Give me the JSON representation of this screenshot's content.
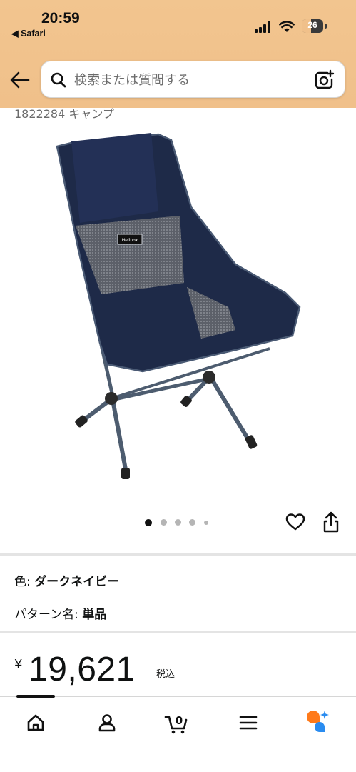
{
  "status_bar": {
    "time": "20:59",
    "back_app": "◀ Safari",
    "battery": "26"
  },
  "search": {
    "placeholder": "検索または質問する"
  },
  "product": {
    "cut_text": "1822284 キャンプ",
    "image_logo": "Helinox",
    "image_count": 5,
    "selected_image_index": 0
  },
  "attributes": [
    {
      "label": "色: ",
      "value": "ダークネイビー"
    },
    {
      "label": "パターン名: ",
      "value": "単品"
    }
  ],
  "price": {
    "currency": "¥",
    "amount": "19,621",
    "tax_label": "税込"
  },
  "bottom_nav": {
    "items": [
      "home-icon",
      "account-icon",
      "cart-icon",
      "menu-icon",
      "rufus-icon"
    ],
    "cart_count": "0",
    "active_index": 0
  },
  "colors": {
    "header_bg": "#f0c08a",
    "chair_navy": "#1e2a48",
    "chair_frame": "#4d5c6f",
    "rufus_orange": "#ff7a1a",
    "rufus_blue": "#2a8cf0"
  }
}
